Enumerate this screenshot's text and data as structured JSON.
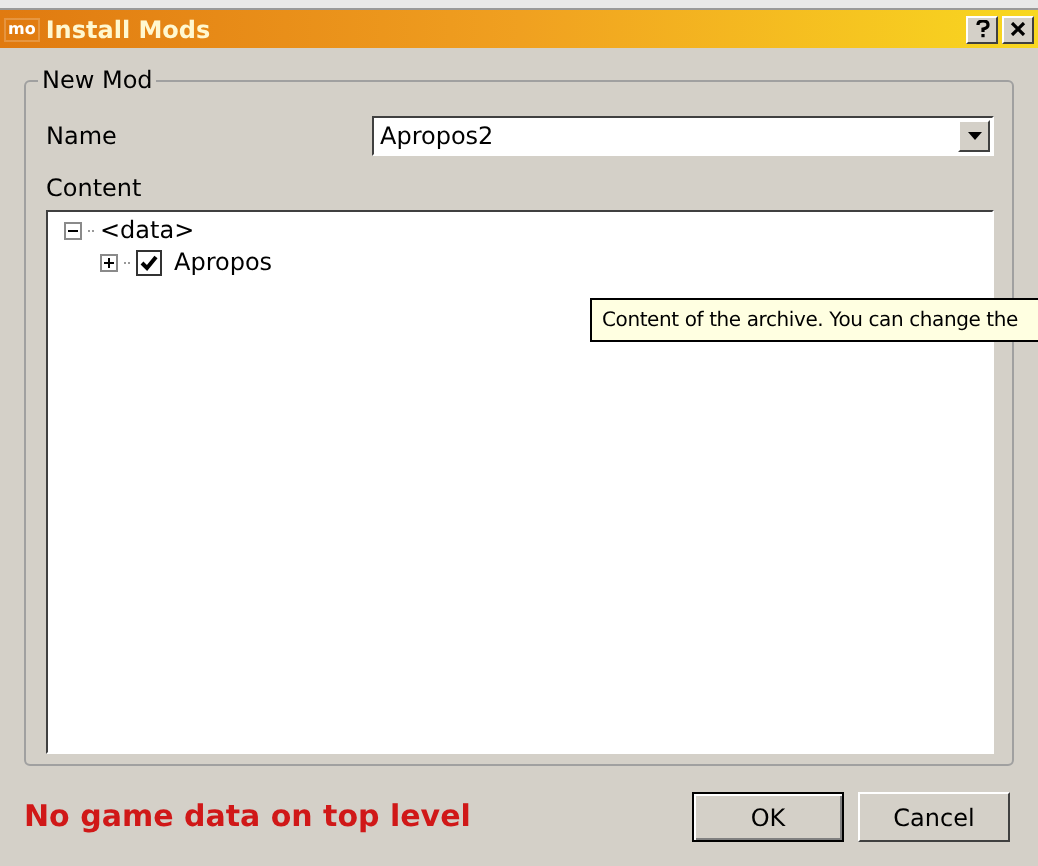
{
  "window": {
    "title": "Install Mods",
    "icon_text": "mo"
  },
  "group": {
    "title": "New Mod"
  },
  "name_field": {
    "label": "Name",
    "value": "Apropos2"
  },
  "content": {
    "label": "Content",
    "tree": [
      {
        "label": "<data>",
        "expanded": true,
        "children": [
          {
            "label": "Apropos",
            "expanded": false,
            "checked": true
          }
        ]
      }
    ]
  },
  "tooltip": {
    "text": "Content of the archive. You can change the"
  },
  "error": "No game data on top level",
  "buttons": [
    {
      "label": "OK",
      "default": true
    },
    {
      "label": "Cancel",
      "default": false
    }
  ]
}
